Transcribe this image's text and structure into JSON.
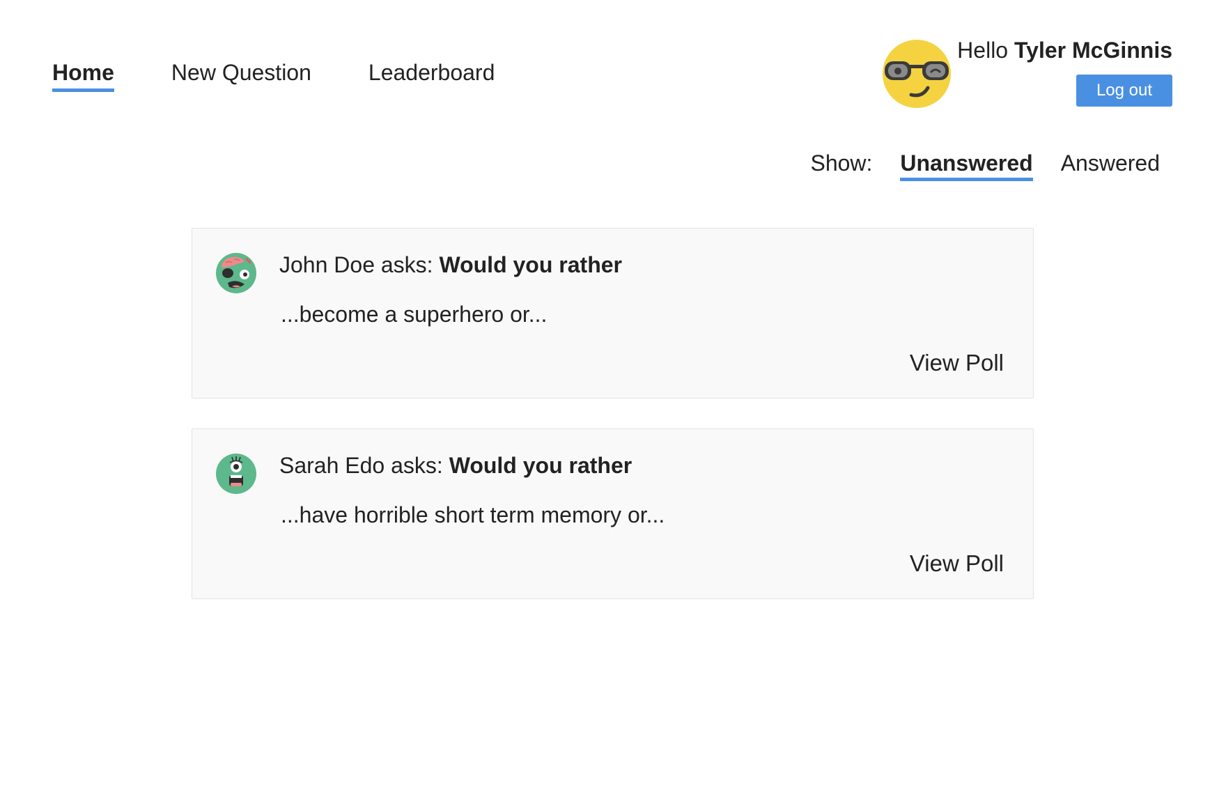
{
  "nav": {
    "items": [
      {
        "label": "Home",
        "active": true
      },
      {
        "label": "New Question",
        "active": false
      },
      {
        "label": "Leaderboard",
        "active": false
      }
    ]
  },
  "user": {
    "greeting_prefix": "Hello",
    "name": "Tyler McGinnis",
    "avatar_icon": "sunglasses-emoji-icon",
    "logout_label": "Log out"
  },
  "filter": {
    "label": "Show:",
    "options": [
      {
        "label": "Unanswered",
        "active": true
      },
      {
        "label": "Answered",
        "active": false
      }
    ]
  },
  "questions": [
    {
      "author": "John Doe",
      "asks_text": "asks:",
      "question": "Would you rather",
      "preview": "...become a superhero or...",
      "view_label": "View Poll",
      "avatar_icon": "zombie-avatar-icon"
    },
    {
      "author": "Sarah Edo",
      "asks_text": "asks:",
      "question": "Would you rather",
      "preview": "...have horrible short term memory or...",
      "view_label": "View Poll",
      "avatar_icon": "cyclops-monster-avatar-icon"
    }
  ],
  "colors": {
    "accent": "#4a90e2",
    "card_bg": "#f9f9f9",
    "avatar_face": "#f5d340",
    "monster_green": "#5db88b"
  }
}
